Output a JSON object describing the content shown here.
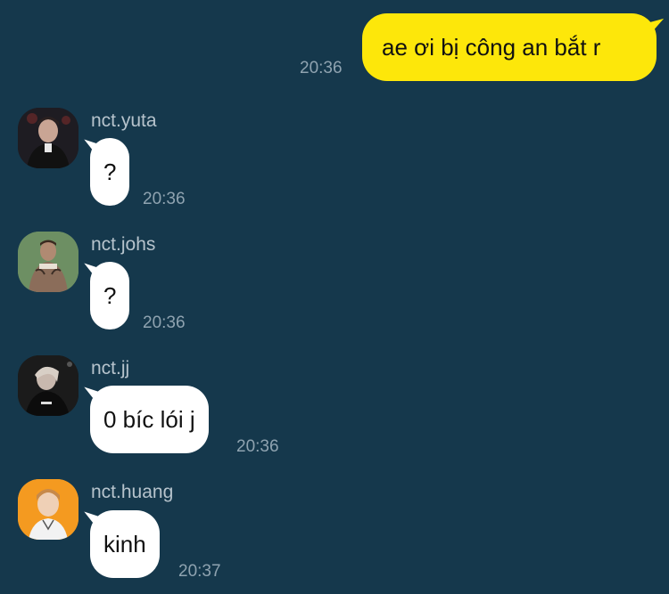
{
  "outgoing": {
    "text": "ae ơi bị công an bắt r",
    "time": "20:36"
  },
  "messages": [
    {
      "sender": "nct.yuta",
      "text": "?",
      "time": "20:36",
      "avatar_color": "#1e1c22"
    },
    {
      "sender": "nct.johs",
      "text": "?",
      "time": "20:36",
      "avatar_color": "#6d8f63"
    },
    {
      "sender": "nct.jj",
      "text": "0 bíc lói j",
      "time": "20:36",
      "avatar_color": "#1b1b1b"
    },
    {
      "sender": "nct.huang",
      "text": "kinh",
      "time": "20:37",
      "avatar_color": "#f49a20"
    }
  ],
  "colors": {
    "background": "#15384c",
    "outgoing_bubble": "#fde70a",
    "incoming_bubble": "#ffffff",
    "timestamp": "#8fa3b0",
    "sender_name": "#b6c3cc"
  }
}
